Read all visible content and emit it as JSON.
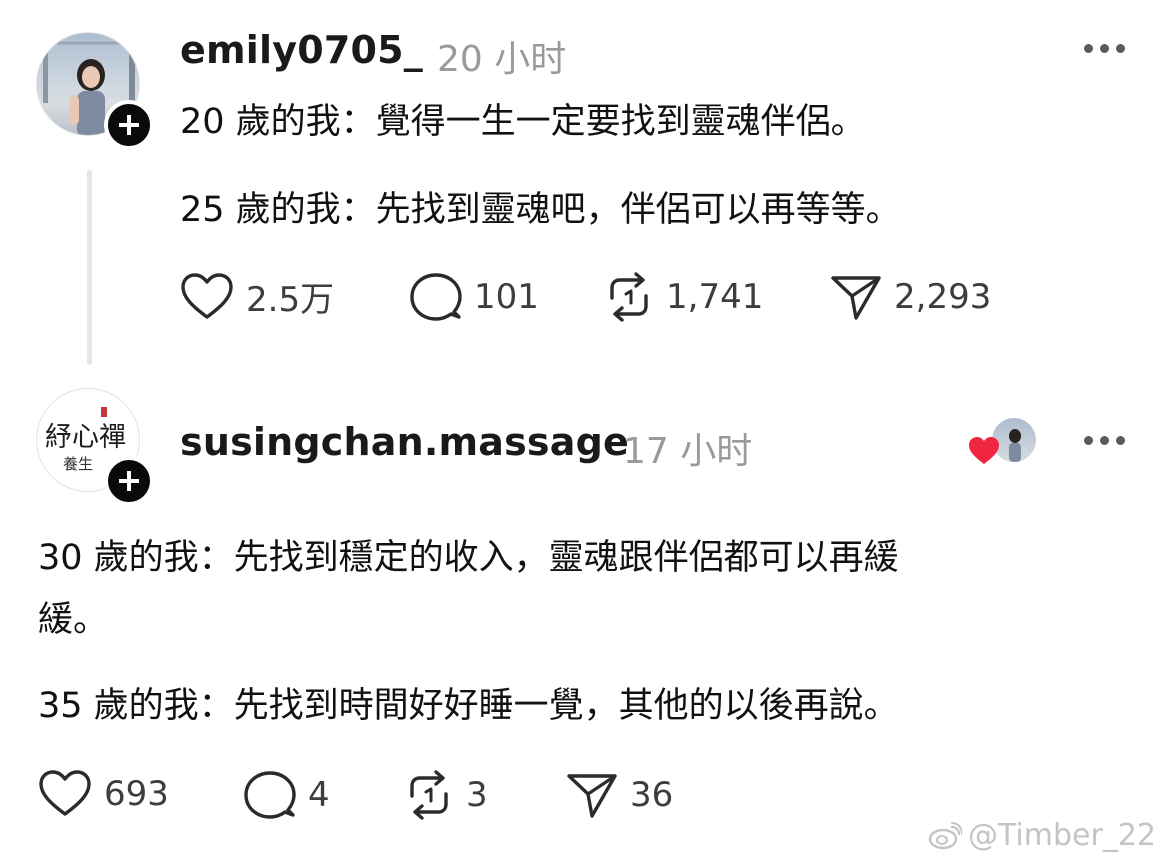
{
  "post1": {
    "username": "emily0705_",
    "time": "20 小时",
    "lines": [
      "20 歲的我：覺得一生一定要找到靈魂伴侶。",
      "25 歲的我：先找到靈魂吧，伴侶可以再等等。"
    ],
    "actions": {
      "likes": "2.5万",
      "replies": "101",
      "reposts": "1,741",
      "shares": "2,293"
    }
  },
  "post2": {
    "username": "susingchan.massage",
    "time": "17 小时",
    "avatar_logo": {
      "line1": "紓心禪",
      "line2": "養生"
    },
    "lines": [
      "30 歲的我：先找到穩定的收入，靈魂跟伴侶都可以再緩",
      "緩。",
      "35 歲的我：先找到時間好好睡一覺，其他的以後再說。"
    ],
    "actions": {
      "likes": "693",
      "replies": "4",
      "reposts": "3",
      "shares": "36"
    }
  },
  "watermark": "@Timber_22",
  "colors": {
    "like_heart": "#f0263e",
    "plus_bg": "#0a0a0a",
    "muted": "#9a9a9a"
  }
}
